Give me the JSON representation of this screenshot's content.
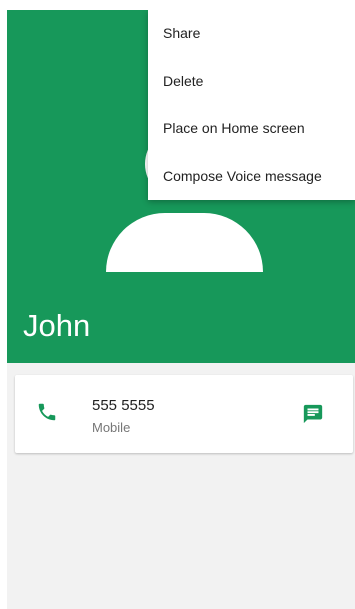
{
  "contact": {
    "name": "John"
  },
  "menu": {
    "items": [
      {
        "label": "Share"
      },
      {
        "label": "Delete"
      },
      {
        "label": "Place on Home screen"
      },
      {
        "label": "Compose Voice message"
      }
    ]
  },
  "phone_entry": {
    "number": "555 5555",
    "type": "Mobile",
    "call_icon": "phone-icon",
    "message_icon": "message-icon"
  },
  "colors": {
    "accent": "#17985a",
    "background": "#f2f2f2",
    "menu_background": "#ffffff"
  }
}
